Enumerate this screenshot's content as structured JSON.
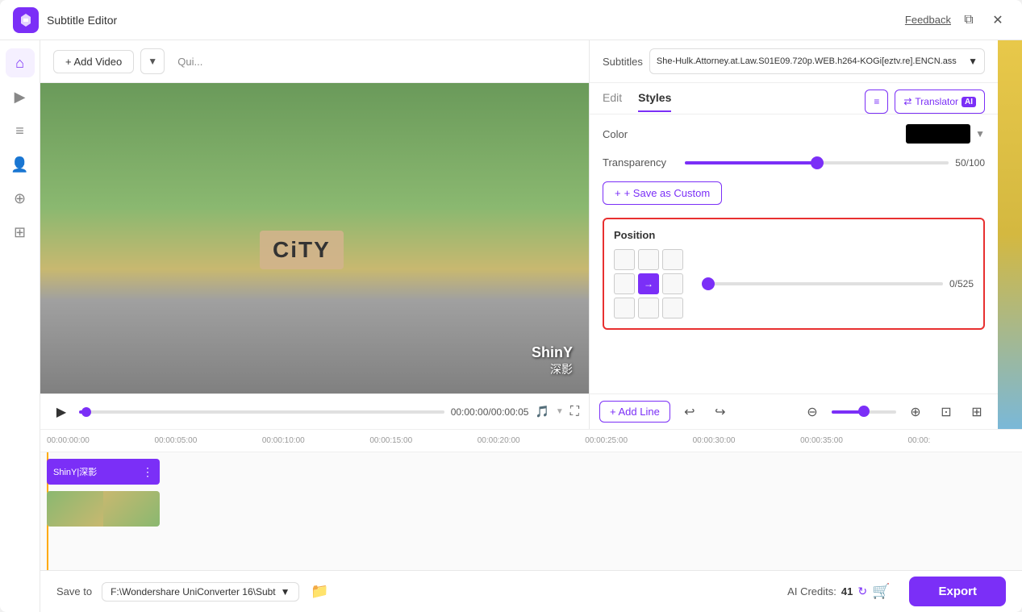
{
  "app": {
    "title": "Subtitle Editor",
    "logo_color": "#7b2ff7"
  },
  "titlebar": {
    "feedback_label": "Feedback",
    "restore_label": "⧉",
    "close_label": "✕"
  },
  "toolbar": {
    "add_video_label": "+ Add Video"
  },
  "video": {
    "time_display": "00:00:00/00:00:05",
    "subtitle_main": "ShinY",
    "subtitle_cn": "深影",
    "city_sign": "CiTY"
  },
  "right_panel": {
    "subtitle_file": "She-Hulk.Attorney.at.Law.S01E09.720p.WEB.h264-KOGi[eztv.re].ENCN.ass",
    "tab_edit": "Edit",
    "tab_styles": "Styles",
    "btn_list": "≡",
    "btn_translator": "Translator",
    "ai_badge": "AI",
    "color_label": "Color",
    "transparency_label": "Transparency",
    "transparency_value": "50/100",
    "save_custom_label": "+ Save as Custom",
    "position_title": "Position",
    "position_value": "0/525"
  },
  "subtitle_bar": {
    "add_line_label": "+ Add Line",
    "undo_label": "↩",
    "redo_label": "↪"
  },
  "timeline": {
    "marks": [
      "00:00:00:00",
      "00:00:05:00",
      "00:00:10:00",
      "00:00:15:00",
      "00:00:20:00",
      "00:00:25:00",
      "00:00:30:00",
      "00:00:35:00",
      "00:00:"
    ],
    "subtitle_track_text": "ShinY|深影"
  },
  "footer": {
    "save_to_label": "Save to",
    "save_path": "F:\\Wondershare UniConverter 16\\Subt",
    "ai_credits_label": "AI Credits:",
    "credits_value": "41",
    "export_label": "Export"
  }
}
